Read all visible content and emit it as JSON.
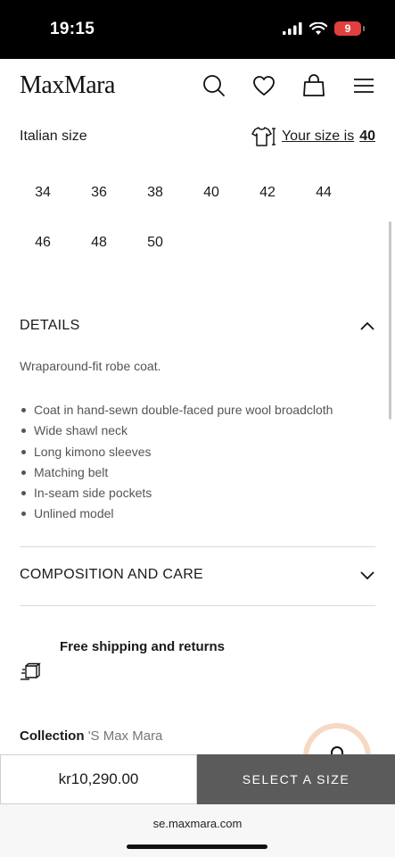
{
  "status": {
    "time": "19:15",
    "battery": "9"
  },
  "header": {
    "logo": "MaxMara"
  },
  "size": {
    "label": "Italian size",
    "your_size_text": "Your size is",
    "your_size_value": "40",
    "options": [
      "34",
      "36",
      "38",
      "40",
      "42",
      "44",
      "46",
      "48",
      "50"
    ]
  },
  "details": {
    "title": "DETAILS",
    "intro": "Wraparound-fit robe coat.",
    "bullets": [
      "Coat in hand-sewn double-faced pure wool broadcloth",
      "Wide shawl neck",
      "Long kimono sleeves",
      "Matching belt",
      "In-seam side pockets",
      "Unlined model"
    ]
  },
  "composition": {
    "title": "COMPOSITION AND CARE"
  },
  "shipping": {
    "title": "Free shipping and returns"
  },
  "collection": {
    "label": "Collection",
    "value": "'S Max Mara"
  },
  "purchase": {
    "price": "kr10,290.00",
    "select_label": "SELECT A SIZE"
  },
  "browser": {
    "url": "se.maxmara.com"
  },
  "icons": {
    "search": "search-icon",
    "wishlist": "heart-icon",
    "bag": "shopping-bag-icon",
    "menu": "hamburger-menu-icon",
    "size_guide": "tshirt-size-icon",
    "chevron_up": "chevron-up-icon",
    "chevron_down": "chevron-down-icon",
    "shipping": "package-icon"
  }
}
